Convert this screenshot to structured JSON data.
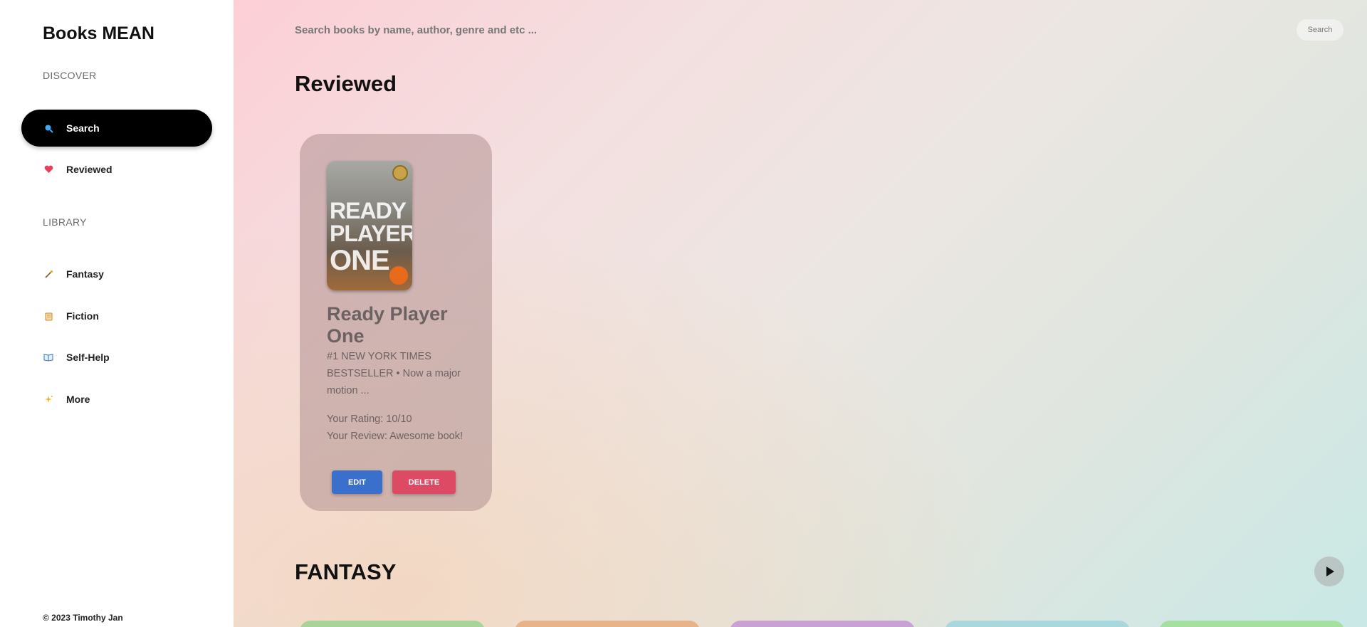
{
  "sidebar": {
    "brand": "Books MEAN",
    "discover_label": "DISCOVER",
    "library_label": "LIBRARY",
    "discover_items": [
      {
        "label": "Search",
        "icon": "search-icon"
      },
      {
        "label": "Reviewed",
        "icon": "heart-icon"
      }
    ],
    "library_items": [
      {
        "label": "Fantasy",
        "icon": "wand-icon"
      },
      {
        "label": "Fiction",
        "icon": "scroll-icon"
      },
      {
        "label": "Self-Help",
        "icon": "book-icon"
      },
      {
        "label": "More",
        "icon": "sparkles-icon"
      }
    ],
    "footer": "© 2023 Timothy Jan"
  },
  "search": {
    "placeholder": "Search books by name, author, genre and etc ...",
    "button_label": "Search"
  },
  "reviewed": {
    "heading": "Reviewed",
    "books": [
      {
        "cover_lines": [
          "READY",
          "PLAYER",
          "ONE"
        ],
        "title": "Ready Player One",
        "description": "#1 NEW YORK TIMES BESTSELLER • Now a major motion ...",
        "rating_text": "Your Rating: 10/10",
        "review_text": "Your Review: Awesome book!",
        "edit_label": "EDIT",
        "delete_label": "DELETE"
      }
    ]
  },
  "fantasy": {
    "heading": "FANTASY"
  },
  "colors": {
    "active_nav": "#000000",
    "edit_button": "#3a6fcc",
    "delete_button": "#dd4a64",
    "card_peeks": [
      "#a8d49a",
      "#e7b48a",
      "#c9a2d4",
      "#a8d8dc",
      "#a6e0a0"
    ]
  }
}
